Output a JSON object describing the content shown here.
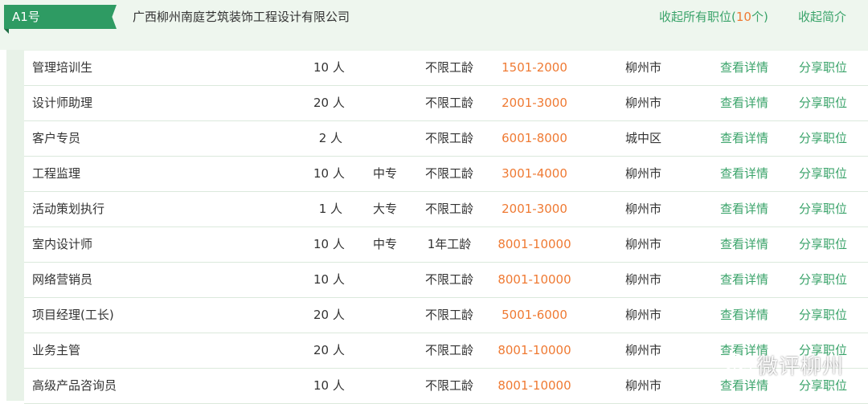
{
  "header": {
    "tag": "A1号",
    "company": "广西柳州南庭艺筑装饰工程设计有限公司",
    "collapse_prefix": "收起所有职位(",
    "collapse_count": "10",
    "collapse_suffix": "个)",
    "collapse_intro": "收起简介"
  },
  "jobs": [
    {
      "title": "管理培训生",
      "num": "10 人",
      "edu": "",
      "exp": "不限工龄",
      "salary": "1501-2000",
      "loc": "柳州市",
      "detail": "查看详情",
      "share": "分享职位"
    },
    {
      "title": "设计师助理",
      "num": "20 人",
      "edu": "",
      "exp": "不限工龄",
      "salary": "2001-3000",
      "loc": "柳州市",
      "detail": "查看详情",
      "share": "分享职位"
    },
    {
      "title": "客户专员",
      "num": "2 人",
      "edu": "",
      "exp": "不限工龄",
      "salary": "6001-8000",
      "loc": "城中区",
      "detail": "查看详情",
      "share": "分享职位"
    },
    {
      "title": "工程监理",
      "num": "10 人",
      "edu": "中专",
      "exp": "不限工龄",
      "salary": "3001-4000",
      "loc": "柳州市",
      "detail": "查看详情",
      "share": "分享职位"
    },
    {
      "title": "活动策划执行",
      "num": "1 人",
      "edu": "大专",
      "exp": "不限工龄",
      "salary": "2001-3000",
      "loc": "柳州市",
      "detail": "查看详情",
      "share": "分享职位"
    },
    {
      "title": "室内设计师",
      "num": "10 人",
      "edu": "中专",
      "exp": "1年工龄",
      "salary": "8001-10000",
      "loc": "柳州市",
      "detail": "查看详情",
      "share": "分享职位"
    },
    {
      "title": "网络营销员",
      "num": "10 人",
      "edu": "",
      "exp": "不限工龄",
      "salary": "8001-10000",
      "loc": "柳州市",
      "detail": "查看详情",
      "share": "分享职位"
    },
    {
      "title": "项目经理(工长)",
      "num": "20 人",
      "edu": "",
      "exp": "不限工龄",
      "salary": "5001-6000",
      "loc": "柳州市",
      "detail": "查看详情",
      "share": "分享职位"
    },
    {
      "title": "业务主管",
      "num": "20 人",
      "edu": "",
      "exp": "不限工龄",
      "salary": "8001-10000",
      "loc": "柳州市",
      "detail": "查看详情",
      "share": "分享职位"
    },
    {
      "title": "高级产品咨询员",
      "num": "10 人",
      "edu": "",
      "exp": "不限工龄",
      "salary": "8001-10000",
      "loc": "柳州市",
      "detail": "查看详情",
      "share": "分享职位"
    }
  ],
  "watermark": {
    "text": "微评柳州",
    "icon": "wechat-icon"
  }
}
